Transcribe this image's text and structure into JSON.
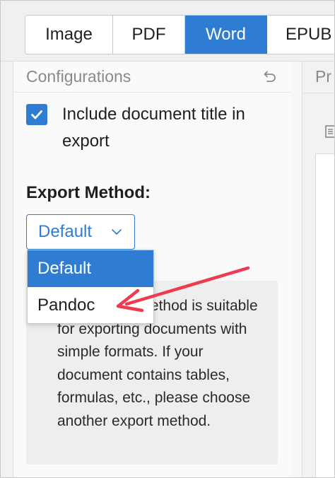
{
  "tabs": [
    {
      "label": "Image",
      "active": false
    },
    {
      "label": "PDF",
      "active": false
    },
    {
      "label": "Word",
      "active": true
    },
    {
      "label": "EPUB",
      "active": false
    }
  ],
  "panel": {
    "title": "Configurations",
    "undo_icon": "undo-icon"
  },
  "options": {
    "include_title": {
      "checked": true,
      "label": "Include document title in export"
    }
  },
  "export_method": {
    "label": "Export Method:",
    "selected": "Default",
    "dropdown_options": [
      "Default",
      "Pandoc"
    ],
    "description": "The Default method is suitable for exporting documents with simple formats. If your document contains tables, formulas, etc., please choose another export method."
  },
  "preview": {
    "title": "Pr"
  },
  "colors": {
    "accent": "#2f7cd3",
    "annotation_arrow": "#ee3b4f"
  }
}
